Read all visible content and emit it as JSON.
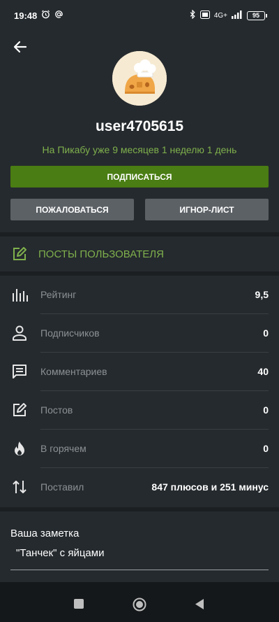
{
  "status": {
    "time": "19:48",
    "network": "4G+",
    "battery": "95"
  },
  "profile": {
    "username": "user4705615",
    "since": "На Пикабу уже 9 месяцев 1 неделю 1 день",
    "subscribe_label": "ПОДПИСАТЬСЯ",
    "report_label": "ПОЖАЛОВАТЬСЯ",
    "ignore_label": "ИГНОР-ЛИСТ"
  },
  "posts": {
    "label": "ПОСТЫ ПОЛЬЗОВАТЕЛЯ"
  },
  "stats": [
    {
      "icon": "rating-bars-icon",
      "label": "Рейтинг",
      "value": "9,5"
    },
    {
      "icon": "person-icon",
      "label": "Подписчиков",
      "value": "0"
    },
    {
      "icon": "comment-icon",
      "label": "Комментариев",
      "value": "40"
    },
    {
      "icon": "edit-icon",
      "label": "Постов",
      "value": "0"
    },
    {
      "icon": "flame-icon",
      "label": "В горячем",
      "value": "0"
    },
    {
      "icon": "arrows-updown-icon",
      "label": "Поставил",
      "value": "847 плюсов и 251 минус"
    }
  ],
  "note": {
    "title": "Ваша заметка",
    "text": "\"Танчек\" с яйцами"
  },
  "colors": {
    "accent_green": "#7fb04c",
    "button_green": "#4a7d13",
    "card_bg": "#252a2e",
    "page_bg": "#1b1f22"
  }
}
